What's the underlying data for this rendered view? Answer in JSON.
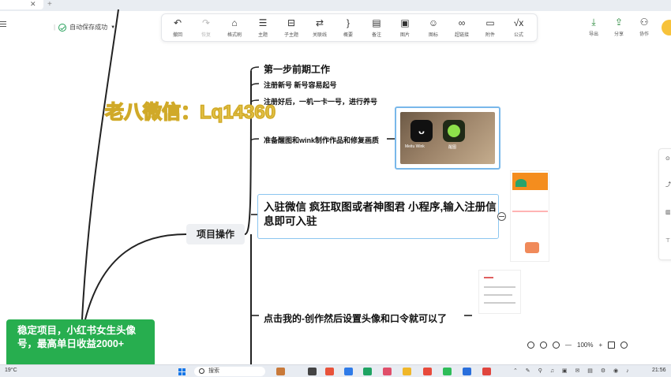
{
  "header": {
    "autosave_status": "自动保存成功"
  },
  "toolbar": {
    "items": [
      {
        "label": "撤回",
        "icon": "undo-icon",
        "glyph": "↶"
      },
      {
        "label": "恢复",
        "icon": "redo-icon",
        "glyph": "↷",
        "disabled": true
      },
      {
        "label": "格式刷",
        "icon": "format-brush-icon",
        "glyph": "⌂"
      },
      {
        "label": "主题",
        "icon": "topic-icon",
        "glyph": "☰"
      },
      {
        "label": "子主题",
        "icon": "subtopic-icon",
        "glyph": "⊟"
      },
      {
        "label": "关联线",
        "icon": "relation-line-icon",
        "glyph": "⇄"
      },
      {
        "label": "概要",
        "icon": "summary-icon",
        "glyph": "}"
      },
      {
        "label": "备注",
        "icon": "note-icon",
        "glyph": "▤"
      },
      {
        "label": "图片",
        "icon": "image-icon",
        "glyph": "▣"
      },
      {
        "label": "图标",
        "icon": "emoji-icon",
        "glyph": "☺"
      },
      {
        "label": "超链接",
        "icon": "link-icon",
        "glyph": "∞"
      },
      {
        "label": "附件",
        "icon": "attachment-icon",
        "glyph": "▭"
      },
      {
        "label": "公式",
        "icon": "formula-icon",
        "glyph": "√x"
      }
    ],
    "right": [
      {
        "label": "导出",
        "icon": "export-icon",
        "glyph": "⤓"
      },
      {
        "label": "分享",
        "icon": "share-icon",
        "glyph": "⇪"
      },
      {
        "label": "协作",
        "icon": "collaborate-icon",
        "glyph": "⚇"
      }
    ]
  },
  "mindmap": {
    "main_node": "项目操作",
    "step1": "第一步前期工作",
    "register": "注册新号    新号容易起号",
    "raise_account": "注册好后，一机一卡一号，进行养号",
    "prepare": "准备醒图和wink制作作品和修复画质",
    "join": "入驻微信   疯狂取图或者神图君  小程序,输入注册信息即可入驻",
    "last_step": "点击我的-创作然后设置头像和口令就可以了",
    "image_labels": {
      "app1": "Meitu Wink",
      "app2": "醒图"
    }
  },
  "watermark": "老八微信：Lq14360",
  "card": {
    "text": "稳定项目，小红书女生头像号，最高单日收益2000+"
  },
  "zoom": {
    "value": "100%",
    "minus": "—",
    "plus": "+"
  },
  "taskbar": {
    "weather": "19°C",
    "search_placeholder": "搜索",
    "time": "21:56"
  },
  "colors": {
    "card_green": "#27ae4f",
    "selection_blue": "#8cc6f0",
    "watermark_gold": "#e3c246"
  }
}
